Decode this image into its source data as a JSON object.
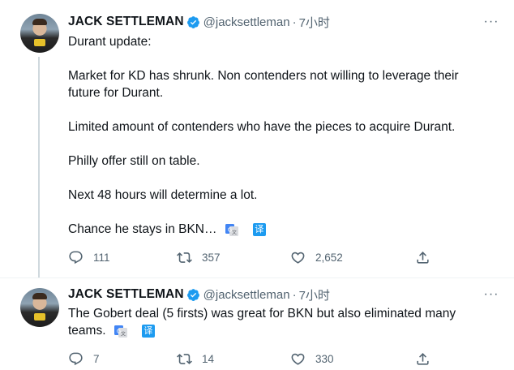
{
  "tweets": [
    {
      "author": {
        "name": "JACK SETTLEMAN",
        "handle": "@jacksettleman",
        "dot": "·",
        "time": "7小时"
      },
      "paragraphs": [
        "Durant update:",
        "Market for KD has shrunk. Non contenders not willing to leverage their future for Durant.",
        "Limited amount of contenders who have the pieces to acquire Durant.",
        "Philly offer still on table.",
        "Next 48 hours will determine a lot.",
        "Chance he stays in BKN…"
      ],
      "translate_label": "译",
      "stats": {
        "replies": "111",
        "retweets": "357",
        "likes": "2,652"
      }
    },
    {
      "author": {
        "name": "JACK SETTLEMAN",
        "handle": "@jacksettleman",
        "dot": "·",
        "time": "7小时"
      },
      "paragraphs": [
        "The Gobert deal (5 firsts) was great for BKN but also eliminated many teams."
      ],
      "translate_label": "译",
      "stats": {
        "replies": "7",
        "retweets": "14",
        "likes": "330"
      }
    }
  ],
  "more_label": "···",
  "colors": {
    "accent": "#1d9bf0",
    "muted": "#536471",
    "thread_line": "#cfd9de"
  },
  "icons": [
    "verified-badge-icon",
    "more-icon",
    "google-translate-icon",
    "translate-icon",
    "reply-icon",
    "retweet-icon",
    "like-icon",
    "share-icon"
  ]
}
